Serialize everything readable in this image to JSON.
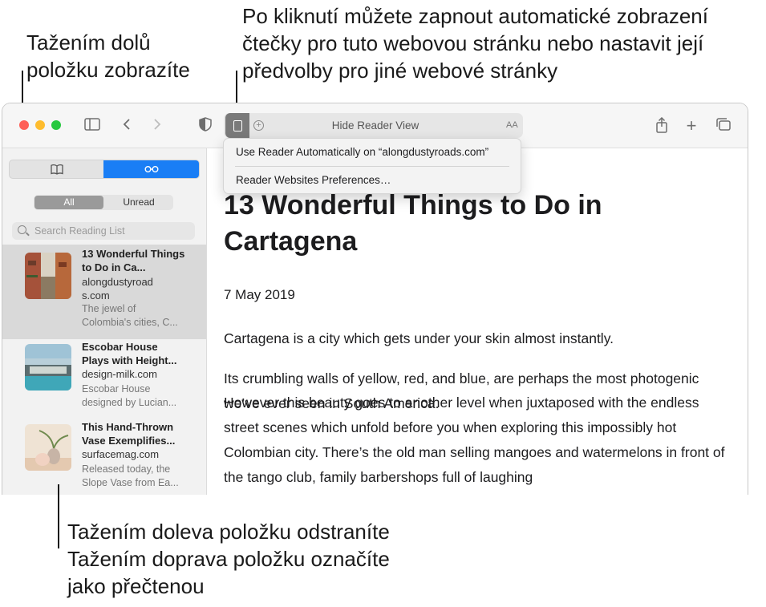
{
  "callouts": {
    "top_left": [
      "Tažením dolů",
      "položku zobrazíte"
    ],
    "top_right": [
      "Po kliknutí můžete zapnout automatické zobrazení",
      "čtečky pro tuto webovou stránku nebo nastavit její",
      "předvolby pro jiné webové stránky"
    ],
    "bottom": [
      "Tažením doleva položku odstraníte",
      "Tažením doprava položku označíte",
      "jako přečtenou"
    ]
  },
  "toolbar": {
    "url_text": "Hide Reader View",
    "text_size_label": "AA"
  },
  "reader_menu": {
    "items": [
      "Use Reader Automatically on “alongdustyroads.com”",
      "Reader Websites Preferences…"
    ]
  },
  "sidebar": {
    "filter": {
      "all": "All",
      "unread": "Unread"
    },
    "search_placeholder": "Search Reading List",
    "items": [
      {
        "title": "13 Wonderful Things to Do in Ca...",
        "host": "alongdustyroads.com",
        "desc": "The jewel of Colombia's cities, C..."
      },
      {
        "title": "Escobar House Plays with Height...",
        "host": "design-milk.com",
        "desc": "Escobar House designed by Lucian..."
      },
      {
        "title": "This Hand-Thrown Vase Exemplifies...",
        "host": "surfacemag.com",
        "desc": "Released today, the Slope Vase from Ea..."
      }
    ]
  },
  "article": {
    "title_line1": "13 Wonderful Things to Do in",
    "title_line2": "Cartagena",
    "date": "7 May 2019",
    "paragraphs": [
      "Cartagena is a city which gets under your skin almost instantly.",
      "Its crumbling walls of yellow, red, and blue, are perhaps the most photogenic we’ve ever seen in South America.",
      "However this beauty goes to another level when juxtaposed with the endless street scenes which unfold before you when exploring this impossibly hot Colombian city. There’s the old man selling mangoes and watermelons in front of the tango club, family barbershops full of laughing"
    ]
  },
  "colors": {
    "accent": "#1a7ef5",
    "close": "#fe5f57",
    "minimize": "#febc2e",
    "zoom": "#28c840"
  }
}
